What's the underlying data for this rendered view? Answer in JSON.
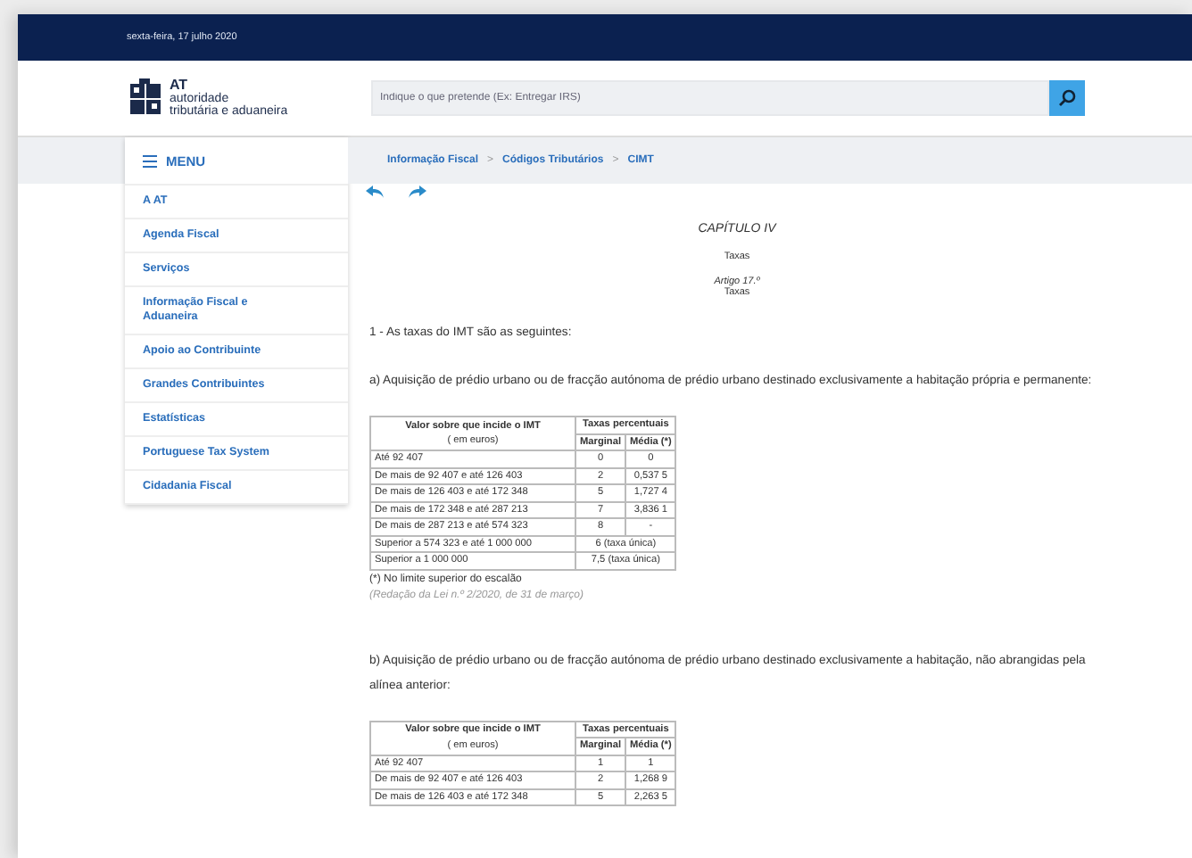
{
  "top_bar": {
    "date": "sexta-feira, 17 julho 2020"
  },
  "header": {
    "logo": {
      "abbr": "AT",
      "line_1": "autoridade",
      "line_2": "tributária e aduaneira"
    },
    "search": {
      "placeholder": "Indique o que pretende (Ex: Entregar IRS)"
    }
  },
  "menu": {
    "title": "MENU",
    "items": [
      {
        "label": "A AT"
      },
      {
        "label": "Agenda Fiscal"
      },
      {
        "label": "Serviços"
      },
      {
        "label": "Informação Fiscal e Aduaneira"
      },
      {
        "label": "Apoio ao Contribuinte"
      },
      {
        "label": "Grandes Contribuintes"
      },
      {
        "label": "Estatísticas"
      },
      {
        "label": "Portuguese Tax System"
      },
      {
        "label": "Cidadania Fiscal"
      }
    ]
  },
  "breadcrumb": [
    {
      "label": "Informação Fiscal",
      "separator": ">"
    },
    {
      "label": "Códigos Tributários",
      "separator": ">"
    },
    {
      "label": "CIMT"
    }
  ],
  "article": {
    "chapter": "CAPÍTULO IV",
    "chapter_title": "Taxas",
    "article": "Artigo 17.º",
    "article_title": "Taxas",
    "intro": "1 - As taxas do IMT são as seguintes:",
    "sections": [
      {
        "text": "a) Aquisição de prédio urbano ou de fracção autónoma de prédio urbano destinado exclusivamente a habitação própria e permanente:",
        "table": {
          "head_value": "Valor sobre que incide o IMT",
          "head_unit": "( em euros)",
          "head_rates": "Taxas percentuais",
          "head_marginal": "Marginal",
          "head_average": "Média (*)",
          "rows": [
            {
              "kind": "split",
              "value": "Até 92 407",
              "marginal": "0",
              "average": "0"
            },
            {
              "kind": "split",
              "value": "De mais de 92 407 e até 126 403",
              "marginal": "2",
              "average": "0,537 5"
            },
            {
              "kind": "split",
              "value": "De mais de 126 403 e até 172 348",
              "marginal": "5",
              "average": "1,727 4"
            },
            {
              "kind": "split",
              "value": "De mais de 172 348 e até 287 213",
              "marginal": "7",
              "average": "3,836 1"
            },
            {
              "kind": "split",
              "value": "De mais de 287 213 e até 574 323",
              "marginal": "8",
              "average": "-"
            },
            {
              "kind": "single",
              "value": "Superior a 574 323 e até 1 000 000",
              "rate": "6 (taxa única)"
            },
            {
              "kind": "single",
              "value": "Superior a 1 000 000",
              "rate": "7,5 (taxa única)"
            }
          ]
        },
        "footnote": "(*) No limite superior do escalão",
        "note": "(Redação da Lei n.º 2/2020, de 31 de março)"
      },
      {
        "text": "b) Aquisição de prédio urbano ou de fracção autónoma de prédio urbano destinado exclusivamente a habitação, não abrangidas pela alínea anterior:",
        "table": {
          "head_value": "Valor sobre que incide o IMT",
          "head_unit": "( em euros)",
          "head_rates": "Taxas percentuais",
          "head_marginal": "Marginal",
          "head_average": "Média (*)",
          "rows": [
            {
              "kind": "split",
              "value": "Até 92 407",
              "marginal": "1",
              "average": "1"
            },
            {
              "kind": "split",
              "value": "De mais de 92 407 e até 126 403",
              "marginal": "2",
              "average": "1,268 9"
            },
            {
              "kind": "split",
              "value": "De mais de 126 403 e até 172 348",
              "marginal": "5",
              "average": "2,263 5"
            }
          ]
        }
      }
    ]
  }
}
